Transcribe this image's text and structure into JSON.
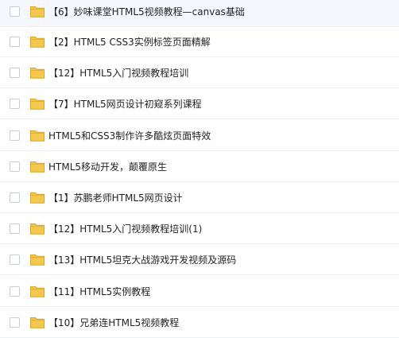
{
  "file_list": {
    "colors": {
      "folder_fill": "#f4c74e",
      "folder_edge": "#d9a52a",
      "row_divider": "#eef1f4",
      "checkbox_border": "#c7ccd2",
      "text": "#222222"
    },
    "items": [
      {
        "name": "【6】妙味课堂HTML5视频教程—canvas基础",
        "icon": "folder-icon"
      },
      {
        "name": "【2】HTML5 CSS3实例标签页面精解",
        "icon": "folder-icon"
      },
      {
        "name": "【12】HTML5入门视频教程培训",
        "icon": "folder-icon"
      },
      {
        "name": "【7】HTML5网页设计初窥系列课程",
        "icon": "folder-icon"
      },
      {
        "name": "HTML5和CSS3制作许多酷炫页面特效",
        "icon": "folder-icon"
      },
      {
        "name": "HTML5移动开发，颠覆原生",
        "icon": "folder-icon"
      },
      {
        "name": "【1】苏鹏老师HTML5网页设计",
        "icon": "folder-icon"
      },
      {
        "name": "【12】HTML5入门视频教程培训(1)",
        "icon": "folder-icon"
      },
      {
        "name": "【13】HTML5坦克大战游戏开发视频及源码",
        "icon": "folder-icon"
      },
      {
        "name": "【11】HTML5实例教程",
        "icon": "folder-icon"
      },
      {
        "name": "【10】兄弟连HTML5视频教程",
        "icon": "folder-icon"
      }
    ]
  }
}
